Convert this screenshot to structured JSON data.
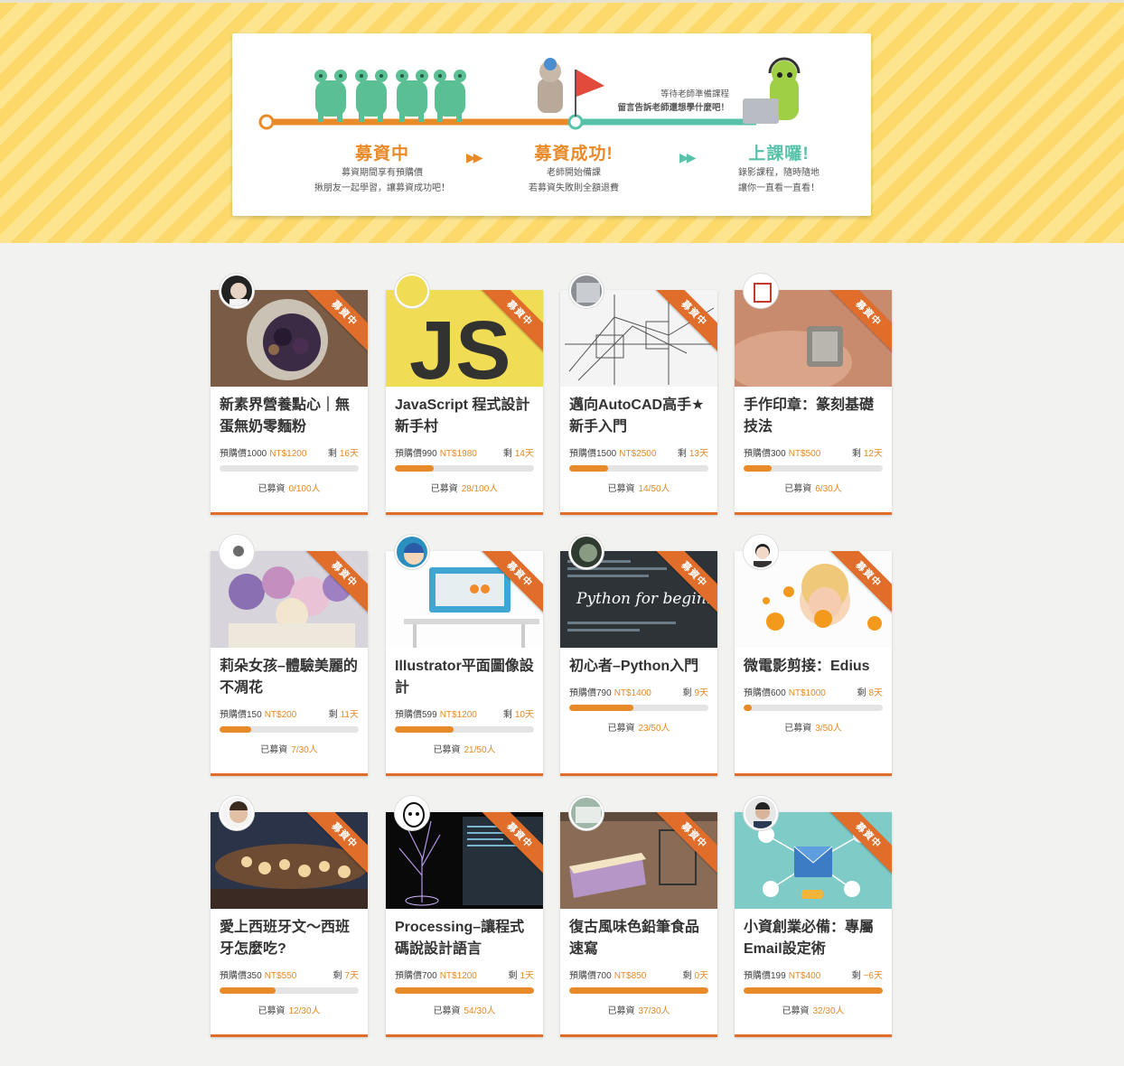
{
  "banner": {
    "steps": [
      {
        "title": "募資中",
        "desc1": "募資期間享有預購價",
        "desc2": "揪朋友一起學習，讓募資成功吧！"
      },
      {
        "title": "募資成功!",
        "desc1": "老師開始備課",
        "desc2": "若募資失敗則全額退費"
      },
      {
        "title": "上課囉!",
        "desc1": "錄影課程，隨時隨地",
        "desc2": "讓你一直看一直看！"
      }
    ],
    "note1": "等待老師準備課程",
    "note2": "留言告訴老師還想學什麼吧！",
    "arrow": "▶▶",
    "colors": {
      "orange": "#e98a29",
      "teal": "#57c2a9",
      "frog": "#5bbf94"
    }
  },
  "labels": {
    "ribbon": "募資中",
    "presale": "預購價",
    "remaining": "剩",
    "raised": "已募資"
  },
  "courses": [
    {
      "title": "新素界營養點心｜無蛋無奶零麵粉",
      "presale": "1000",
      "original": "NT$1200",
      "days": "16天",
      "raised": "0/100人",
      "progress": 0
    },
    {
      "title": "JavaScript 程式設計新手村",
      "presale": "990",
      "original": "NT$1980",
      "days": "14天",
      "raised": "28/100人",
      "progress": 0.28
    },
    {
      "title": "邁向AutoCAD高手★新手入門",
      "presale": "1500",
      "original": "NT$2500",
      "days": "13天",
      "raised": "14/50人",
      "progress": 0.28
    },
    {
      "title": "手作印章：篆刻基礎技法",
      "presale": "300",
      "original": "NT$500",
      "days": "12天",
      "raised": "6/30人",
      "progress": 0.2
    },
    {
      "title": "莉朵女孩–體驗美麗的不凋花",
      "presale": "150",
      "original": "NT$200",
      "days": "11天",
      "raised": "7/30人",
      "progress": 0.23
    },
    {
      "title": "Illustrator平面圖像設計",
      "presale": "599",
      "original": "NT$1200",
      "days": "10天",
      "raised": "21/50人",
      "progress": 0.42
    },
    {
      "title": "初心者–Python入門",
      "presale": "790",
      "original": "NT$1400",
      "days": "9天",
      "raised": "23/50人",
      "progress": 0.46
    },
    {
      "title": "微電影剪接：Edius",
      "presale": "600",
      "original": "NT$1000",
      "days": "8天",
      "raised": "3/50人",
      "progress": 0.06
    },
    {
      "title": "愛上西班牙文～西班牙怎麼吃?",
      "presale": "350",
      "original": "NT$550",
      "days": "7天",
      "raised": "12/30人",
      "progress": 0.4
    },
    {
      "title": "Processing–讓程式碼說設計語言",
      "presale": "700",
      "original": "NT$1200",
      "days": "1天",
      "raised": "54/30人",
      "progress": 1
    },
    {
      "title": "復古風味色鉛筆食品速寫",
      "presale": "700",
      "original": "NT$850",
      "days": "0天",
      "raised": "37/30人",
      "progress": 1
    },
    {
      "title": "小資創業必備：專屬Email設定術",
      "presale": "199",
      "original": "NT$400",
      "days": "−6天",
      "raised": "32/30人",
      "progress": 1
    }
  ]
}
